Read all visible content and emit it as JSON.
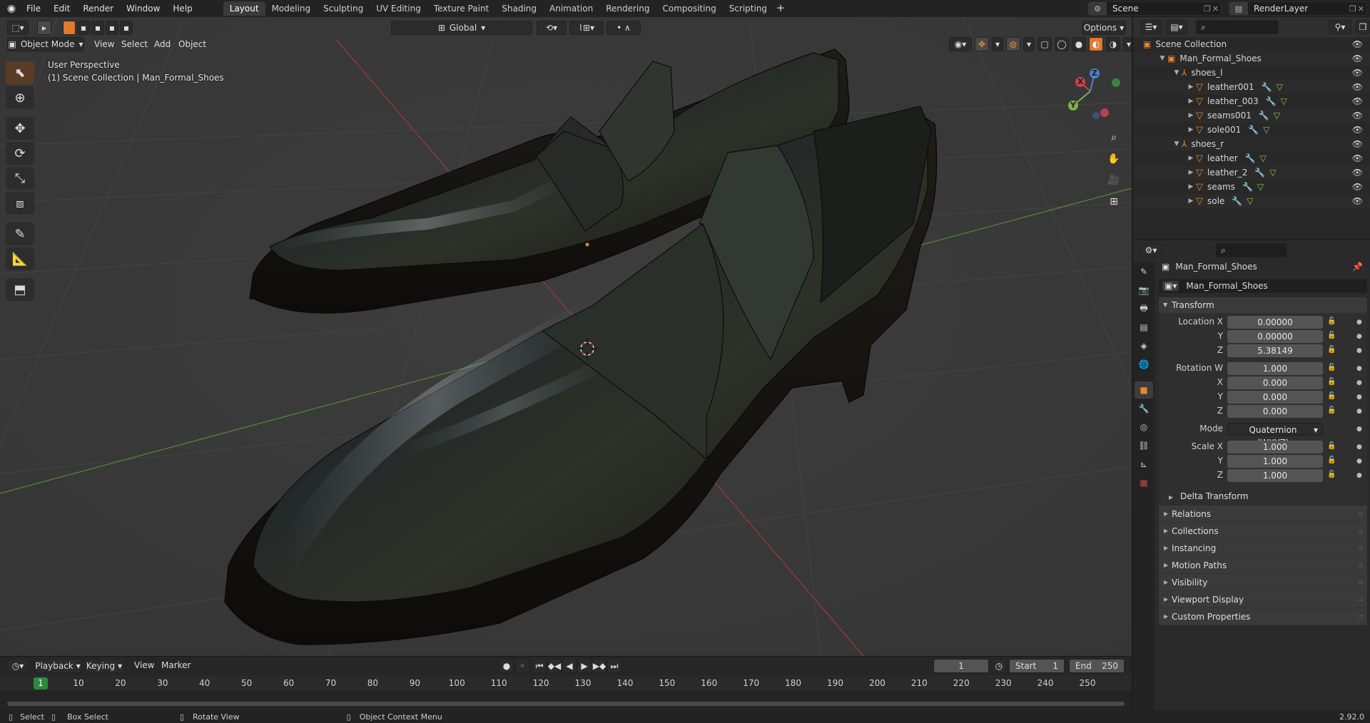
{
  "topbar": {
    "menus": [
      "File",
      "Edit",
      "Render",
      "Window",
      "Help"
    ],
    "workspaces": [
      "Layout",
      "Modeling",
      "Sculpting",
      "UV Editing",
      "Texture Paint",
      "Shading",
      "Animation",
      "Rendering",
      "Compositing",
      "Scripting"
    ],
    "active_workspace": "Layout",
    "add_tab": "+",
    "scene": "Scene",
    "view_layer": "RenderLayer"
  },
  "viewport": {
    "mode": "Object Mode",
    "menus": [
      "View",
      "Select",
      "Add",
      "Object"
    ],
    "transform_orientation": "Global",
    "options_label": "Options",
    "overlay_line1": "User Perspective",
    "overlay_line2": "(1) Scene Collection | Man_Formal_Shoes",
    "gizmo_labels": {
      "x": "X",
      "y": "Y",
      "z": "Z"
    }
  },
  "timeline": {
    "menus": [
      "Playback",
      "Keying",
      "View",
      "Marker"
    ],
    "current_frame": "1",
    "start_label": "Start",
    "start_value": "1",
    "end_label": "End",
    "end_value": "250",
    "ticks": [
      "1",
      "10",
      "20",
      "30",
      "40",
      "50",
      "60",
      "70",
      "80",
      "90",
      "100",
      "110",
      "120",
      "130",
      "140",
      "150",
      "160",
      "170",
      "180",
      "190",
      "200",
      "210",
      "220",
      "230",
      "240",
      "250"
    ]
  },
  "statusbar": {
    "select": "Select",
    "box_select": "Box Select",
    "rotate_view": "Rotate View",
    "context_menu": "Object Context Menu",
    "version": "2.92.0"
  },
  "outliner": {
    "root": "Scene Collection",
    "items": [
      {
        "label": "Man_Formal_Shoes",
        "depth": 1,
        "kind": "collection"
      },
      {
        "label": "shoes_l",
        "depth": 2,
        "kind": "empty"
      },
      {
        "label": "leather001",
        "depth": 3,
        "kind": "mesh"
      },
      {
        "label": "leather_003",
        "depth": 3,
        "kind": "mesh"
      },
      {
        "label": "seams001",
        "depth": 3,
        "kind": "mesh"
      },
      {
        "label": "sole001",
        "depth": 3,
        "kind": "mesh"
      },
      {
        "label": "shoes_r",
        "depth": 2,
        "kind": "empty"
      },
      {
        "label": "leather",
        "depth": 3,
        "kind": "mesh"
      },
      {
        "label": "leather_2",
        "depth": 3,
        "kind": "mesh"
      },
      {
        "label": "seams",
        "depth": 3,
        "kind": "mesh"
      },
      {
        "label": "sole",
        "depth": 3,
        "kind": "mesh"
      }
    ]
  },
  "properties": {
    "object_name": "Man_Formal_Shoes",
    "object_field": "Man_Formal_Shoes",
    "transform_title": "Transform",
    "location": {
      "label": "Location X",
      "x": "0.00000",
      "y": "0.00000",
      "z": "5.38149"
    },
    "rotation": {
      "label": "Rotation W",
      "w": "1.000",
      "x": "0.000",
      "y": "0.000",
      "z": "0.000"
    },
    "mode_label": "Mode",
    "mode_value": "Quaternion (WXYZ)",
    "scale": {
      "label": "Scale X",
      "x": "1.000",
      "y": "1.000",
      "z": "1.000"
    },
    "axis_labels": {
      "x": "X",
      "y": "Y",
      "z": "Z"
    },
    "delta_transform": "Delta Transform",
    "panels": [
      "Relations",
      "Collections",
      "Instancing",
      "Motion Paths",
      "Visibility",
      "Viewport Display",
      "Custom Properties"
    ]
  },
  "colors": {
    "accent": "#e8892c",
    "active_tool": "#5a3b23",
    "x_axis": "#c9434a",
    "y_axis": "#7ab24a",
    "z_axis": "#4a7fd0"
  }
}
